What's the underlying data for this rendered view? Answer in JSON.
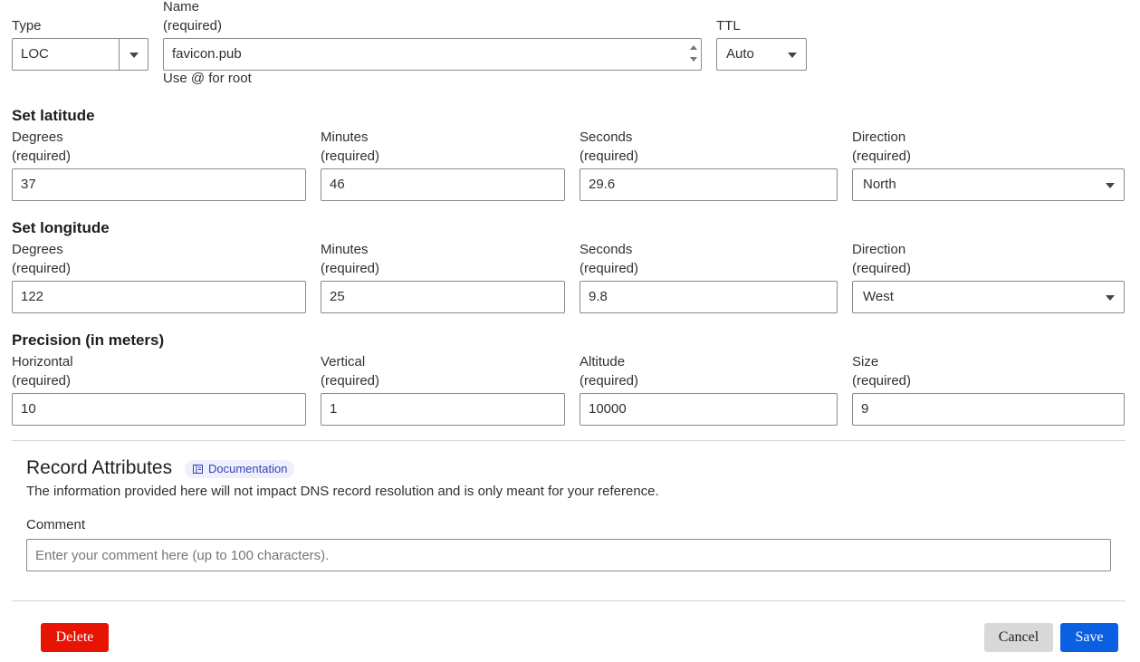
{
  "type_field": {
    "label": "Type",
    "value": "LOC"
  },
  "name_field": {
    "label": "Name",
    "required": "(required)",
    "value": "favicon.pub",
    "hint": "Use @ for root"
  },
  "ttl_field": {
    "label": "TTL",
    "value": "Auto"
  },
  "latitude": {
    "title": "Set latitude",
    "degrees": {
      "label": "Degrees",
      "required": "(required)",
      "value": "37"
    },
    "minutes": {
      "label": "Minutes",
      "required": "(required)",
      "value": "46"
    },
    "seconds": {
      "label": "Seconds",
      "required": "(required)",
      "value": "29.6"
    },
    "direction": {
      "label": "Direction",
      "required": "(required)",
      "value": "North"
    }
  },
  "longitude": {
    "title": "Set longitude",
    "degrees": {
      "label": "Degrees",
      "required": "(required)",
      "value": "122"
    },
    "minutes": {
      "label": "Minutes",
      "required": "(required)",
      "value": "25"
    },
    "seconds": {
      "label": "Seconds",
      "required": "(required)",
      "value": "9.8"
    },
    "direction": {
      "label": "Direction",
      "required": "(required)",
      "value": "West"
    }
  },
  "precision": {
    "title": "Precision (in meters)",
    "horizontal": {
      "label": "Horizontal",
      "required": "(required)",
      "value": "10"
    },
    "vertical": {
      "label": "Vertical",
      "required": "(required)",
      "value": "1"
    },
    "altitude": {
      "label": "Altitude",
      "required": "(required)",
      "value": "10000"
    },
    "size": {
      "label": "Size",
      "required": "(required)",
      "value": "9"
    }
  },
  "record_attributes": {
    "title": "Record Attributes",
    "doc_label": "Documentation",
    "description": "The information provided here will not impact DNS record resolution and is only meant for your reference.",
    "comment_label": "Comment",
    "comment_placeholder": "Enter your comment here (up to 100 characters).",
    "comment_value": ""
  },
  "actions": {
    "delete": "Delete",
    "cancel": "Cancel",
    "save": "Save"
  },
  "colors": {
    "delete": "#e81403",
    "save": "#0a5fe3",
    "cancel": "#d9d9d9",
    "badge": "#eef0fb"
  },
  "icons": {
    "dropdown": "chevron-down-icon",
    "doc": "book-icon",
    "spinner": "spinner-arrows-icon"
  }
}
